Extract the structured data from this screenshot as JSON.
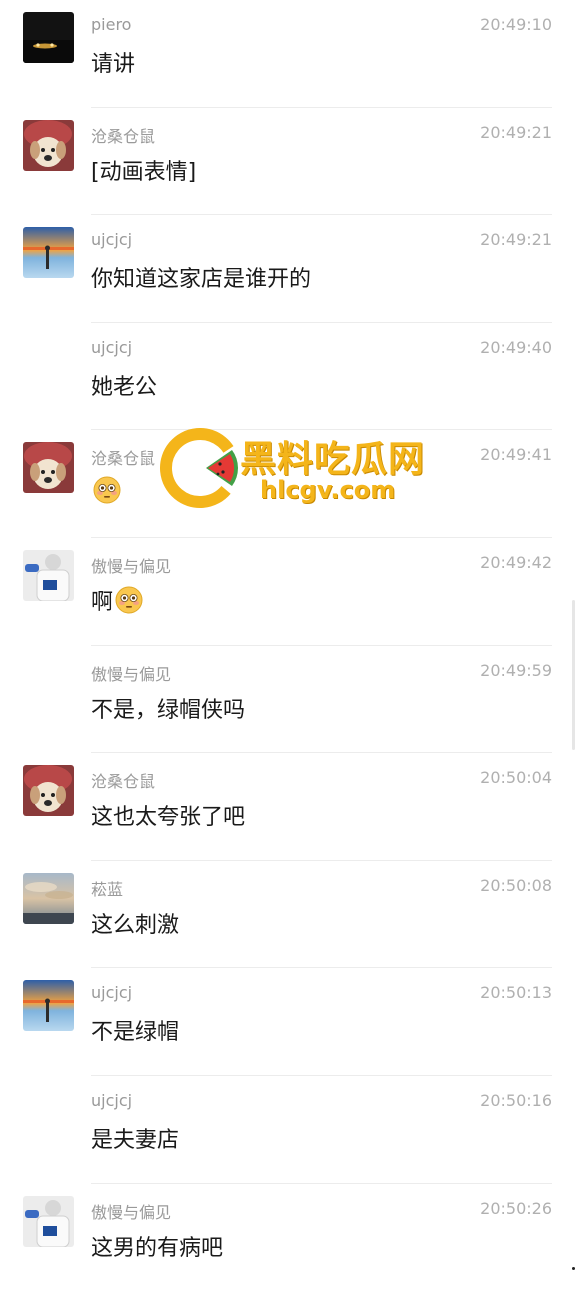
{
  "messages": [
    {
      "name": "piero",
      "time": "20:49:10",
      "text": "请讲",
      "avatar": "night-car-avatar"
    },
    {
      "name": "沧桑仓鼠",
      "time": "20:49:21",
      "text": "[动画表情]",
      "avatar": "dog-avatar"
    },
    {
      "name": "ujcjcj",
      "time": "20:49:21",
      "text": "你知道这家店是谁开的",
      "avatar": "sunset-avatar"
    },
    {
      "name": "ujcjcj",
      "time": "20:49:40",
      "text": "她老公",
      "avatar": "none"
    },
    {
      "name": "沧桑仓鼠",
      "time": "20:49:41",
      "text": "",
      "emoji": "flushed-face-emoji",
      "avatar": "dog-avatar"
    },
    {
      "name": "傲慢与偏见",
      "time": "20:49:42",
      "text": "啊",
      "emoji": "flushed-face-emoji",
      "avatar": "person-avatar"
    },
    {
      "name": "傲慢与偏见",
      "time": "20:49:59",
      "text": "不是，绿帽侠吗",
      "avatar": "none"
    },
    {
      "name": "沧桑仓鼠",
      "time": "20:50:04",
      "text": "这也太夸张了吧",
      "avatar": "dog-avatar"
    },
    {
      "name": "菘蓝",
      "time": "20:50:08",
      "text": "这么刺激",
      "avatar": "sky-avatar"
    },
    {
      "name": "ujcjcj",
      "time": "20:50:13",
      "text": "不是绿帽",
      "avatar": "sunset-avatar"
    },
    {
      "name": "ujcjcj",
      "time": "20:50:16",
      "text": "是夫妻店",
      "avatar": "none"
    },
    {
      "name": "傲慢与偏见",
      "time": "20:50:26",
      "text": "这男的有病吧",
      "avatar": "person-avatar"
    }
  ],
  "watermark": {
    "title": "黑料吃瓜网",
    "url": "hlcgv.com",
    "colors": {
      "gold": "#f4b51a",
      "red": "#e53935",
      "green": "#43a047"
    }
  }
}
